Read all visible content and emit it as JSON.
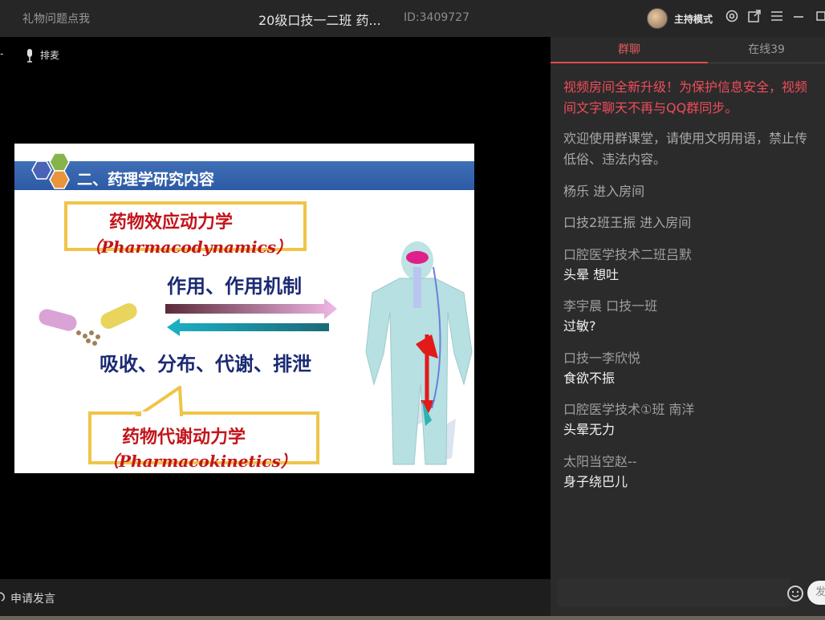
{
  "titlebar": {
    "gift_link": "礼物问题点我",
    "room_title": "20级口技一二班 药...",
    "room_id": "ID:3409727",
    "host_mode": "主持模式"
  },
  "toolbar": {
    "queue": "排麦",
    "dash": "-"
  },
  "slide": {
    "title": "二、药理学研究内容",
    "pd_zh": "药物效应动力学",
    "pd_en": "（Pharmacodynamics）",
    "action": "作用、作用机制",
    "adme": "吸收、分布、代谢、排泄",
    "pk_zh": "药物代谢动力学",
    "pk_en": "（Pharmacokinetics）"
  },
  "bottom": {
    "apply_speak": "申请发言"
  },
  "chat": {
    "tabs": {
      "group": "群聊",
      "online": "在线39"
    },
    "notice_line1": "视频房间全新升级！为保护信息安全，视频",
    "notice_line2": "间文字聊天不再与QQ群同步。",
    "welcome_line1": "欢迎使用群课堂，请使用文明用语，禁止传",
    "welcome_line2": "低俗、违法内容。",
    "join1": "杨乐 进入房间",
    "join2": "口技2班王振 进入房间",
    "m1_sender": "口腔医学技术二班吕默",
    "m1_text": "头晕  想吐",
    "m2_sender": "李宇晨 口技一班",
    "m2_text": "过敏?",
    "m3_sender": "口技一李欣悦",
    "m3_text": "食欲不振",
    "m4_sender": "口腔医学技术①班 南洋",
    "m4_text": "头晕无力",
    "m5_sender": "太阳当空赵--",
    "m5_text": "身子绕巴儿",
    "send_label": "发"
  },
  "colors": {
    "accent": "#e24b4b",
    "notice": "#ef4d5a",
    "slide_blue": "#2d5aa6",
    "slide_red": "#c4141b"
  }
}
